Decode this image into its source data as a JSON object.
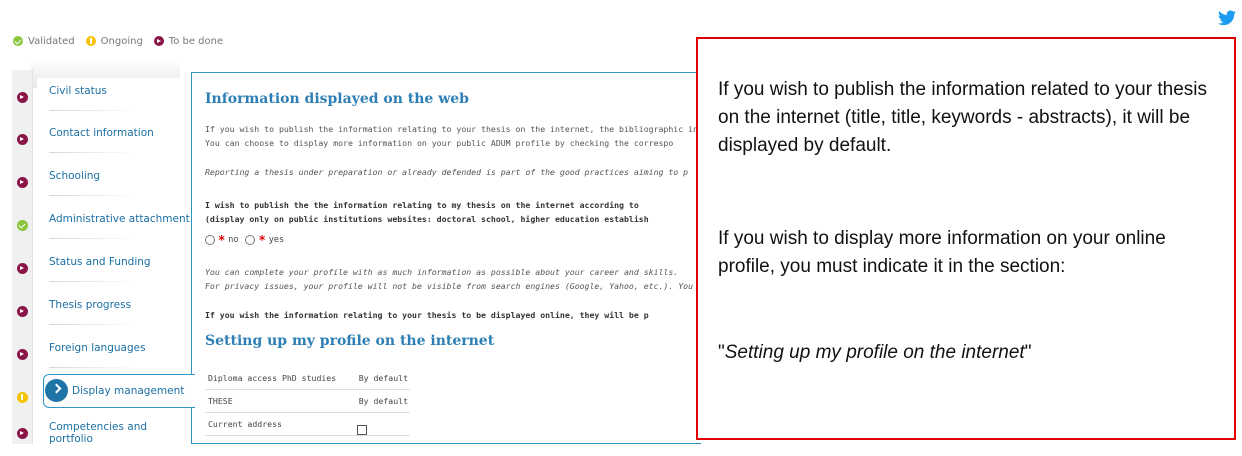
{
  "legend": {
    "validated": "Validated",
    "ongoing": "Ongoing",
    "to_be_done": "To be done"
  },
  "colors": {
    "validated": "#8cc63f",
    "ongoing": "#f5c300",
    "to_be_done": "#8a1548",
    "accent": "#2d7fb5",
    "callout_border": "#e30000"
  },
  "sidebar": {
    "items": [
      {
        "label": "Civil status",
        "status": "to_be_done"
      },
      {
        "label": "Contact information",
        "status": "to_be_done"
      },
      {
        "label": "Schooling",
        "status": "to_be_done"
      },
      {
        "label": "Administrative attachment",
        "status": "validated"
      },
      {
        "label": "Status and Funding",
        "status": "to_be_done"
      },
      {
        "label": "Thesis progress",
        "status": "to_be_done"
      },
      {
        "label": "Foreign languages",
        "status": "to_be_done"
      },
      {
        "label": "Display management",
        "status": "ongoing",
        "active": true
      },
      {
        "label": "Competencies and portfolio",
        "status": "to_be_done"
      }
    ]
  },
  "main": {
    "title": "Information displayed on the web",
    "para1_line1": "If you wish to publish the information relating to your thesis on the internet, the bibliographic info",
    "para1_line2": "You can choose to display more information on your public ADUM profile by checking the correspo",
    "para2": "Reporting a thesis under preparation or already defended is part of the good practices aiming to p",
    "para3_line1": "I wish to publish the the information relating to my thesis on the internet according to",
    "para3_line2": "(display only on public institutions websites: doctoral school, higher education establish",
    "radio_no": "no",
    "radio_yes": "yes",
    "para4_line1": "You can complete your profile with as much information as possible about your career and skills.",
    "para4_line2": "For privacy issues, your profile will not be visible from search engines (Google, Yahoo, etc.). You",
    "para5": "If you wish the information relating to your thesis to be displayed online, they will be p",
    "section_title": "Setting up my profile on the internet",
    "table": [
      {
        "label": "Diploma access PhD studies",
        "value": "By default"
      },
      {
        "label": "THESE",
        "value": "By default"
      },
      {
        "label": "Current address",
        "value": ""
      }
    ]
  },
  "callout": {
    "text1": "If you wish to publish the information related to your thesis on the internet (title, title, keywords - abstracts), it will be displayed by default.",
    "text2": "If you wish to display more information on your online profile, you must indicate it in the section:",
    "quote_open": "\"",
    "quote_text": "Setting up my profile on the internet",
    "quote_close": "\""
  }
}
